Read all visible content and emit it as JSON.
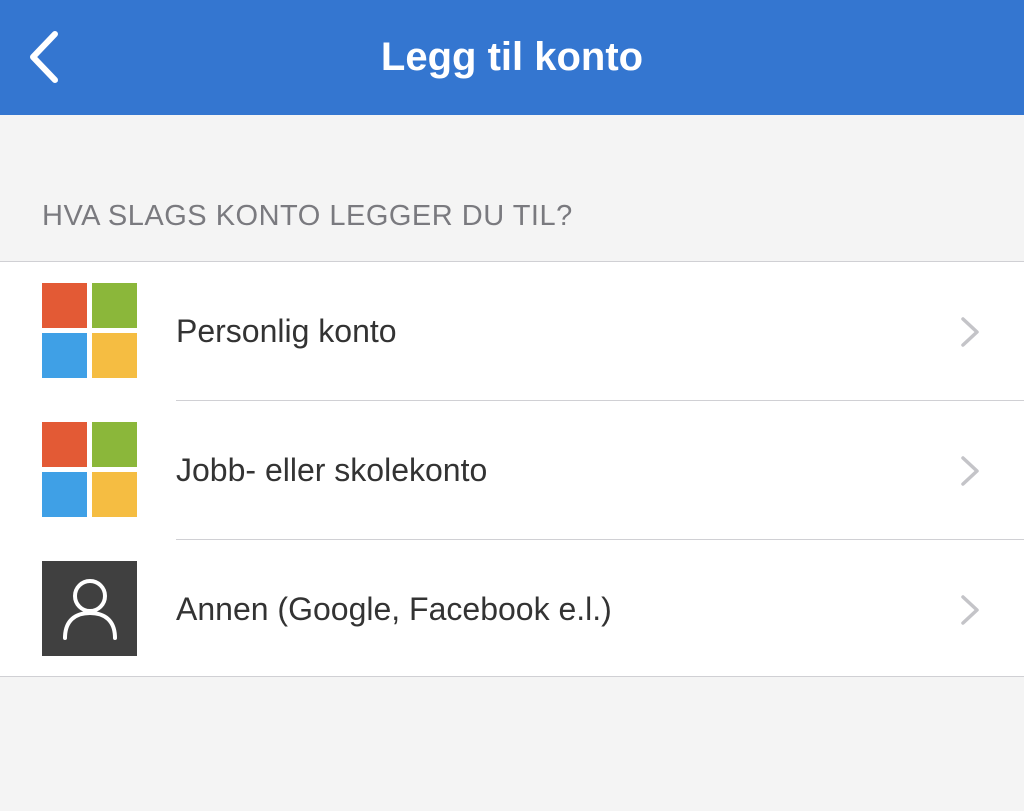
{
  "navbar": {
    "title": "Legg til konto",
    "back_icon": "chevron-left-icon",
    "background_color": "#3476d0"
  },
  "section": {
    "header": "HVA SLAGS KONTO LEGGER DU TIL?"
  },
  "account_options": [
    {
      "label": "Personlig konto",
      "icon": "microsoft-logo-icon"
    },
    {
      "label": "Jobb- eller skolekonto",
      "icon": "microsoft-logo-icon"
    },
    {
      "label": "Annen (Google, Facebook e.l.)",
      "icon": "person-icon"
    }
  ],
  "colors": {
    "ms_red": "#e35a35",
    "ms_green": "#8bb73a",
    "ms_blue": "#3fa0e6",
    "ms_yellow": "#f5bd42",
    "person_icon_bg": "#404040"
  }
}
